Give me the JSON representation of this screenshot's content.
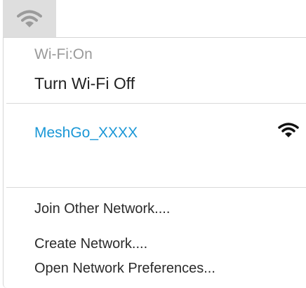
{
  "menubar": {
    "icon": "wifi-icon"
  },
  "menu": {
    "status_text": "Wi-Fi:On",
    "toggle_label": "Turn Wi-Fi Off",
    "networks": [
      {
        "name": "MeshGo_XXXX",
        "signal_icon": "wifi-signal-icon"
      }
    ],
    "actions": [
      {
        "label": "Join Other Network...."
      },
      {
        "label": "Create Network...."
      },
      {
        "label": "Open Network Preferences..."
      }
    ]
  },
  "colors": {
    "network_name": "#1a97d6",
    "menubar_highlight": "#dedede",
    "icon_gray": "#9b9b9b",
    "status_text": "#9a9a9a"
  }
}
